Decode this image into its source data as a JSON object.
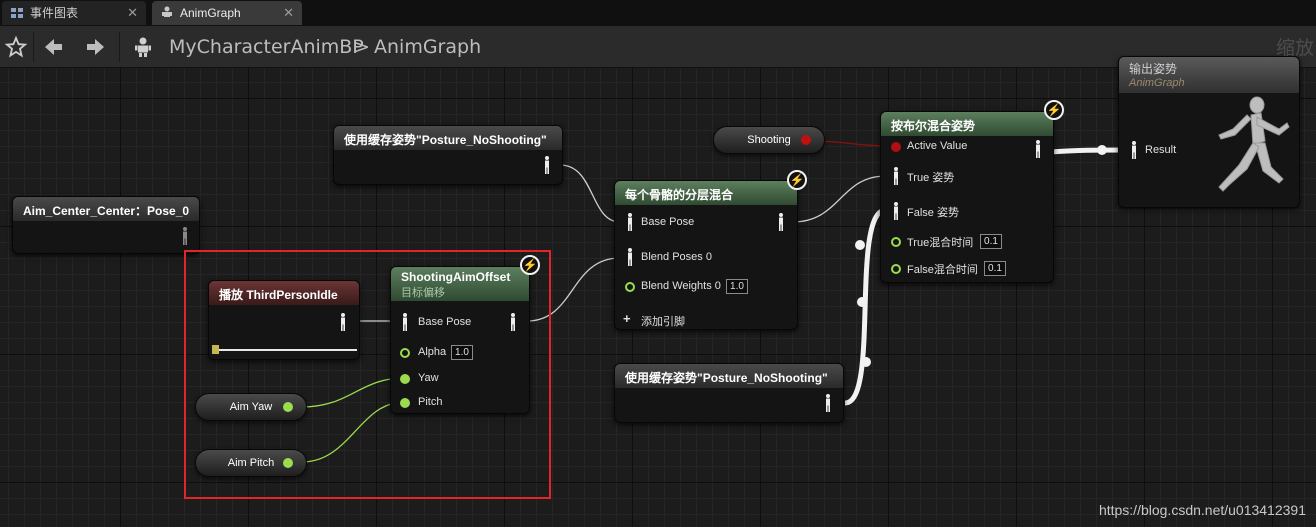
{
  "tabs": [
    {
      "label": "事件图表",
      "icon": "event-graph-icon",
      "active": false
    },
    {
      "label": "AnimGraph",
      "icon": "anim-graph-icon",
      "active": true
    }
  ],
  "toolbar": {
    "breadcrumb": [
      "MyCharacterAnimBP",
      "AnimGraph"
    ],
    "separator": ">",
    "zoom_label": "缩放"
  },
  "nodes": {
    "aim_center": {
      "title": "Aim_Center_Center：Pose_0"
    },
    "cached_pose_top": {
      "title": "使用缓存姿势\"Posture_NoShooting\""
    },
    "cached_pose_bottom": {
      "title": "使用缓存姿势\"Posture_NoShooting\""
    },
    "play_idle": {
      "title": "播放 ThirdPersonIdle",
      "progress": 0.02
    },
    "aim_offset": {
      "title": "ShootingAimOffset",
      "subtitle": "目标偏移",
      "pins": {
        "base_pose": "Base Pose",
        "alpha": "Alpha",
        "alpha_value": "1.0",
        "yaw": "Yaw",
        "pitch": "Pitch"
      }
    },
    "aim_yaw": {
      "label": "Aim Yaw"
    },
    "aim_pitch": {
      "label": "Aim Pitch"
    },
    "layered_blend": {
      "title": "每个骨骼的分层混合",
      "pins": {
        "base_pose": "Base Pose",
        "blend_poses": "Blend Poses 0",
        "blend_weights": "Blend Weights 0",
        "blend_weights_value": "1.0",
        "add_pin": "添加引脚"
      }
    },
    "shooting": {
      "label": "Shooting"
    },
    "bool_blend": {
      "title": "按布尔混合姿势",
      "pins": {
        "active_value": "Active Value",
        "true_pose": "True 姿势",
        "false_pose": "False 姿势",
        "true_blend_time": "True混合时间",
        "true_blend_time_value": "0.1",
        "false_blend_time": "False混合时间",
        "false_blend_time_value": "0.1"
      }
    },
    "output_pose": {
      "title": "输出姿势",
      "subtitle": "AnimGraph",
      "pins": {
        "result": "Result"
      }
    }
  },
  "colors": {
    "highlight": "#e0252b",
    "float_pin": "#9bdc4e",
    "bool_pin": "#b01010",
    "wire": "#d8d8d8"
  },
  "watermark": "https://blog.csdn.net/u013412391"
}
